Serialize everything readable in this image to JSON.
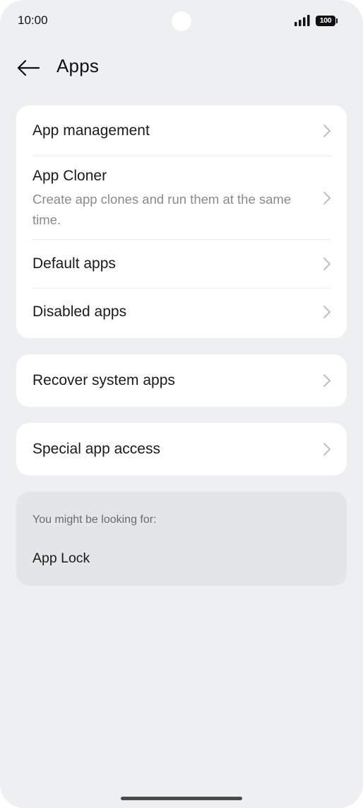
{
  "status_bar": {
    "time": "10:00",
    "battery_level": "100",
    "signal_icon": "signal-bars-icon",
    "battery_icon": "battery-icon"
  },
  "header": {
    "back_icon": "arrow-left-icon",
    "title": "Apps"
  },
  "main_group": {
    "items": [
      {
        "title": "App management",
        "subtitle": ""
      },
      {
        "title": "App Cloner",
        "subtitle": "Create app clones and run them at the same time."
      },
      {
        "title": "Default apps",
        "subtitle": ""
      },
      {
        "title": "Disabled apps",
        "subtitle": ""
      }
    ]
  },
  "recover_group": {
    "title": "Recover system apps"
  },
  "special_group": {
    "title": "Special app access"
  },
  "suggestions": {
    "heading": "You might be looking for:",
    "items": [
      "App Lock"
    ]
  },
  "colors": {
    "background": "#eeeff1",
    "card": "#ffffff",
    "suggestion_card": "#e4e5e7",
    "primary_text": "#1a1a1a",
    "secondary_text": "#8a8a8a",
    "chevron": "#b8b8b8"
  }
}
